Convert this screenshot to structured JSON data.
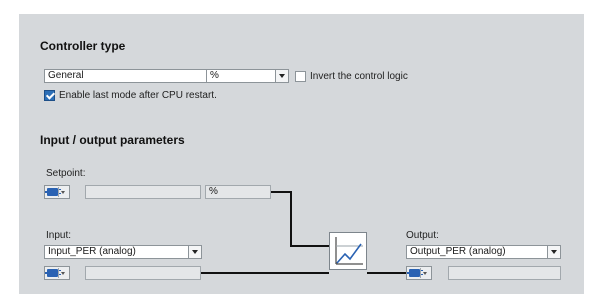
{
  "controller_type": {
    "heading": "Controller type",
    "type_select": "General",
    "unit_select": "%",
    "invert_label": "Invert the control logic",
    "invert_checked": false,
    "enable_label": "Enable last mode after CPU restart.",
    "enable_checked": true
  },
  "io_params": {
    "heading": "Input / output parameters",
    "setpoint": {
      "label": "Setpoint:",
      "value": "",
      "unit": "%"
    },
    "input": {
      "label": "Input:",
      "select": "Input_PER (analog)",
      "value": ""
    },
    "output": {
      "label": "Output:",
      "select": "Output_PER (analog)",
      "value": ""
    }
  },
  "icons": {
    "parameter_source": "plug-connector-icon",
    "controller": "pid-response-curve-icon"
  },
  "colors": {
    "panel_background": "#d5d8db",
    "checkbox_checked": "#2c6fb7",
    "connector_icon": "#2a62b3",
    "controller_curve": "#2a62b3"
  }
}
